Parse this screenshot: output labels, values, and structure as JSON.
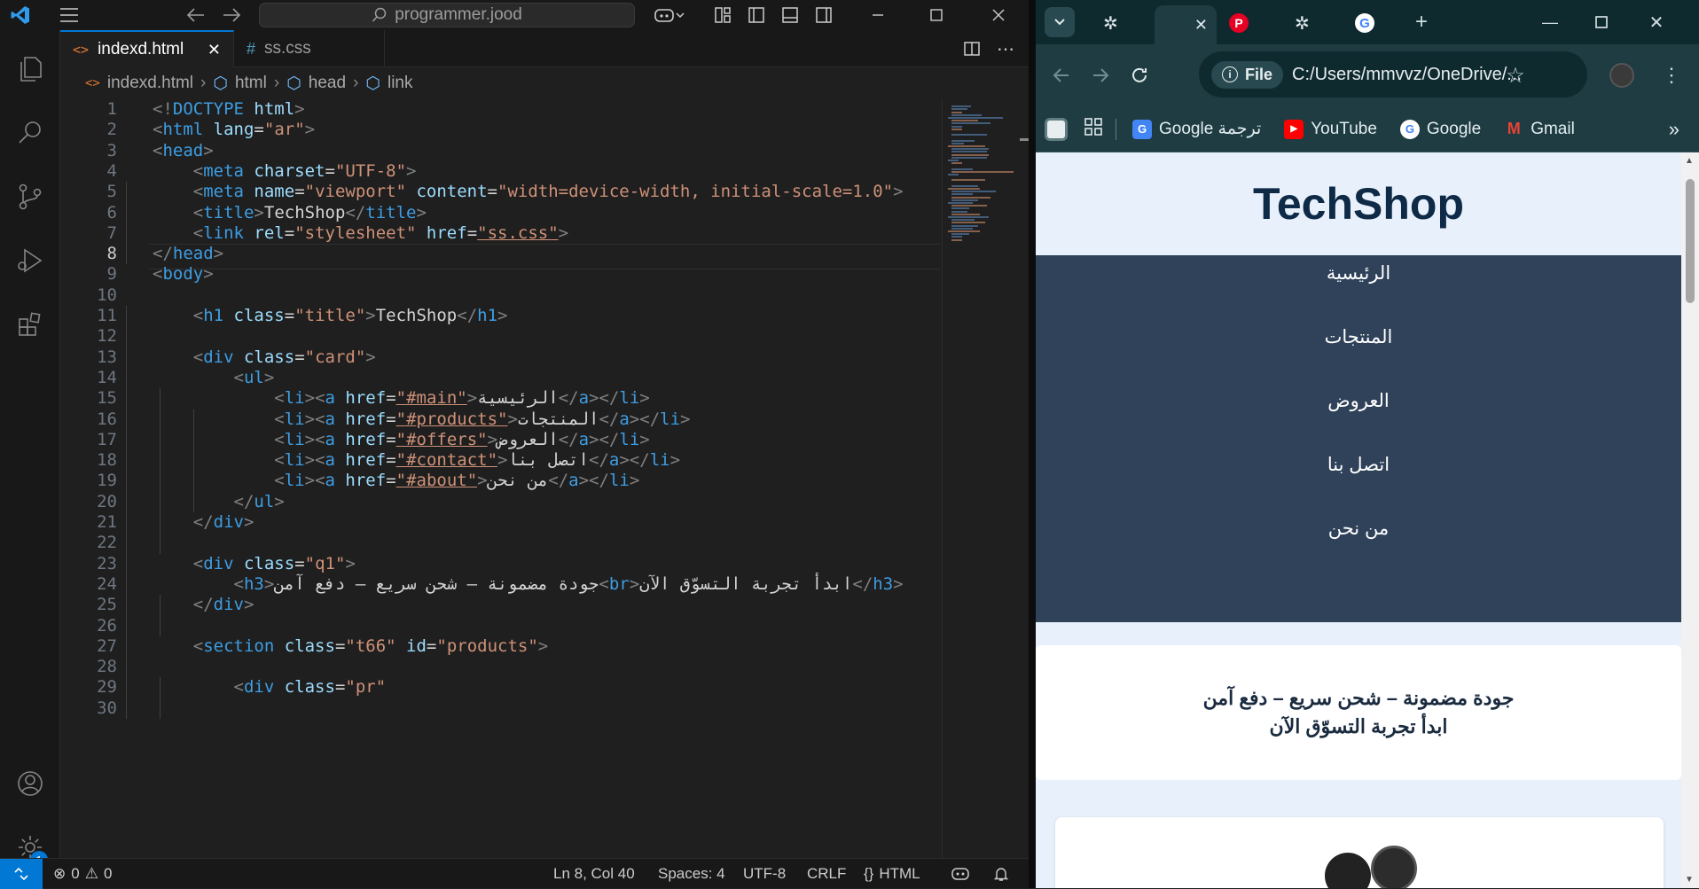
{
  "vscode": {
    "search_text": "programmer.jood",
    "tabs": [
      {
        "label": "indexd.html",
        "icon": "html-icon"
      },
      {
        "label": "ss.css",
        "icon": "css-icon"
      }
    ],
    "breadcrumb": [
      "indexd.html",
      "html",
      "head",
      "link"
    ],
    "current_line": 8,
    "status": {
      "problems_errors": "0",
      "problems_warnings": "0",
      "position": "Ln 8, Col 40",
      "spaces": "Spaces: 4",
      "encoding": "UTF-8",
      "eol": "CRLF",
      "language": "HTML",
      "accounts_badge": "1"
    }
  },
  "chrome": {
    "url_chip": "File",
    "url": "C:/Users/mmvvz/OneDrive/...",
    "bookmarks": [
      {
        "label": "Google ترجمة",
        "icon": "google-translate-icon"
      },
      {
        "label": "YouTube",
        "icon": "youtube-icon"
      },
      {
        "label": "Google",
        "icon": "google-icon"
      },
      {
        "label": "Gmail",
        "icon": "gmail-icon"
      }
    ],
    "site": {
      "title": "TechShop",
      "nav": [
        "الرئيسية",
        "المنتجات",
        "العروض",
        "اتصل بنا",
        "من نحن"
      ],
      "q1_line1": "جودة مضمونة – شحن سريع – دفع آمن",
      "q1_line2": "ابدأ تجربة التسوّق الآن"
    }
  }
}
